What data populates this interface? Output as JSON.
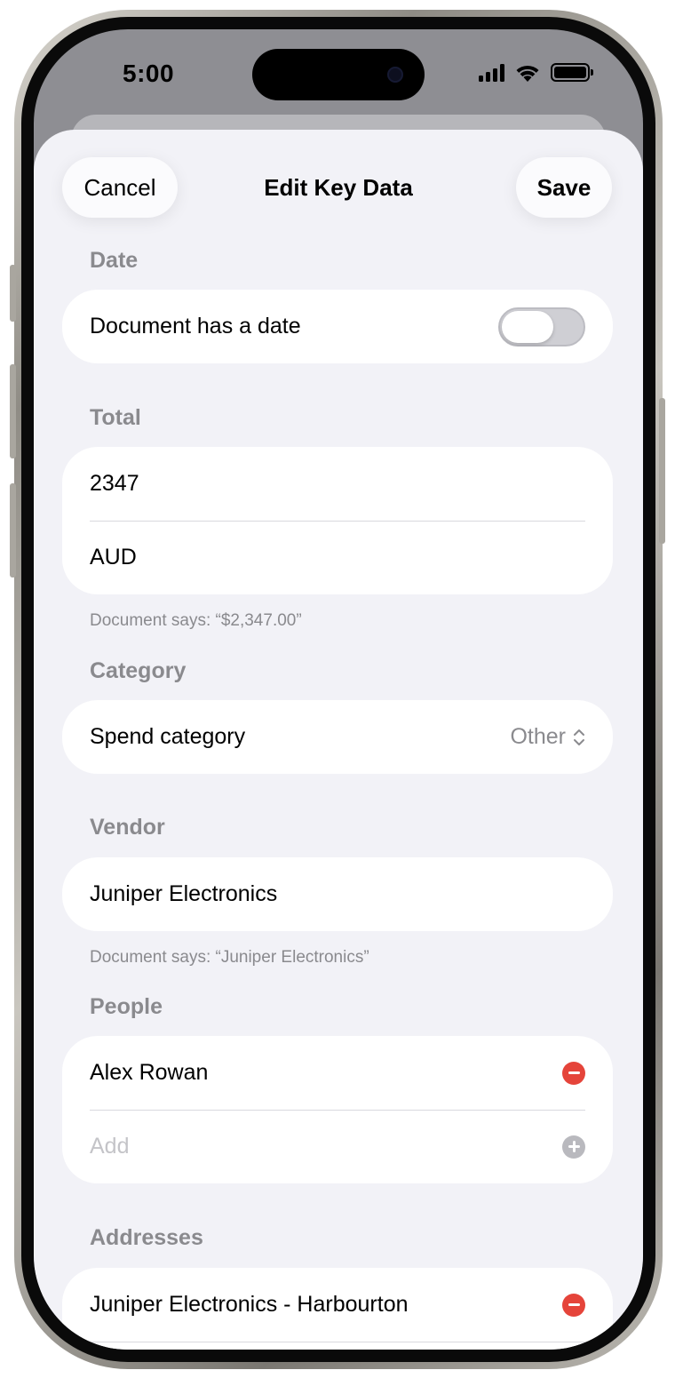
{
  "status_bar": {
    "time": "5:00"
  },
  "nav": {
    "cancel_label": "Cancel",
    "title": "Edit Key Data",
    "save_label": "Save"
  },
  "date": {
    "header": "Date",
    "toggle_label": "Document has a date",
    "toggle_on": false
  },
  "total": {
    "header": "Total",
    "amount": "2347",
    "currency": "AUD",
    "note": "Document says: “$2,347.00”"
  },
  "category": {
    "header": "Category",
    "label": "Spend category",
    "value": "Other"
  },
  "vendor": {
    "header": "Vendor",
    "value": "Juniper Electronics",
    "note": "Document says: “Juniper Electronics”"
  },
  "people": {
    "header": "People",
    "items": [
      "Alex Rowan"
    ],
    "add_placeholder": "Add"
  },
  "addresses": {
    "header": "Addresses",
    "items": [
      "Juniper Electronics - Harbourton"
    ]
  },
  "colors": {
    "accent_destructive": "#e5443a",
    "background": "#f2f2f7",
    "secondary_text": "#8a8a8e"
  }
}
